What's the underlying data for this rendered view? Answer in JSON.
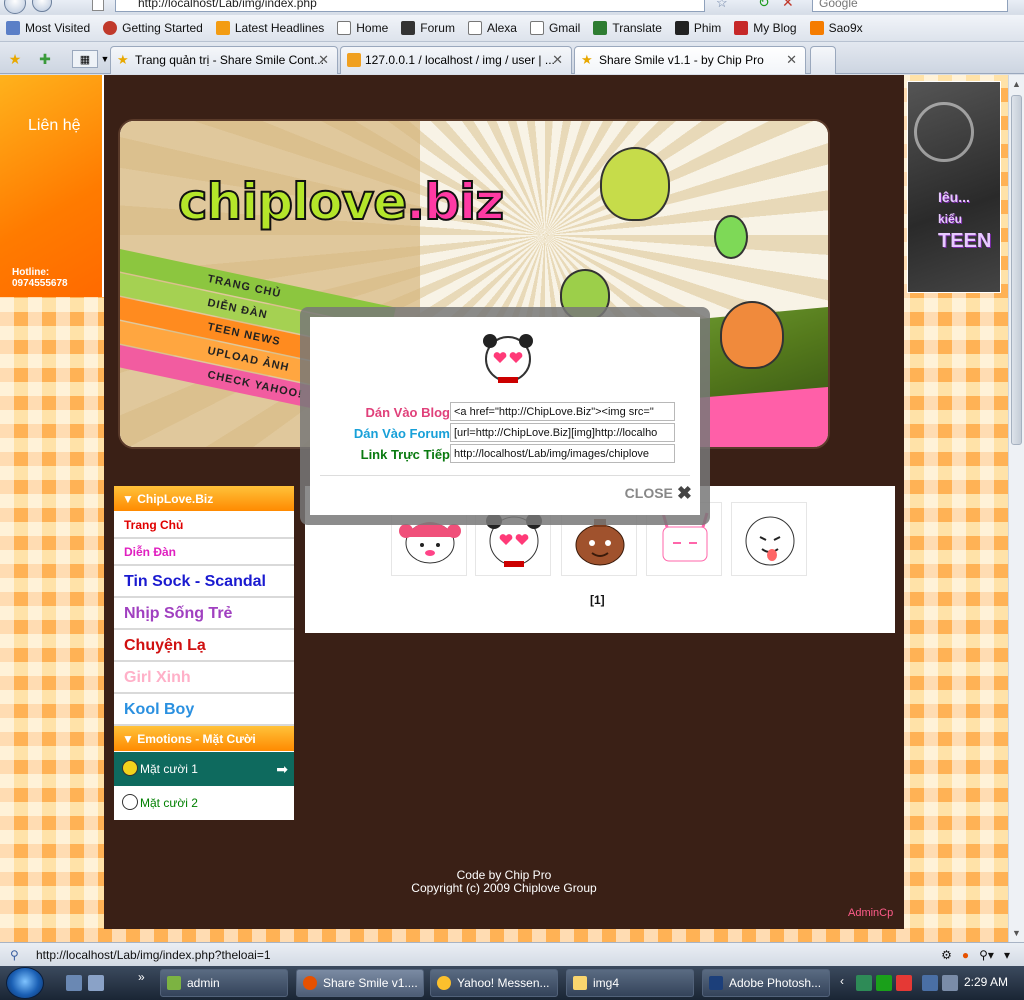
{
  "browser": {
    "url": "http://localhost/Lab/img/index.php",
    "search_placeholder": "Google",
    "bookmarks": [
      {
        "label": "Most Visited",
        "icon": "most-visited-icon",
        "color": "#5b7fc7"
      },
      {
        "label": "Getting Started",
        "icon": "firefox-icon",
        "color": "#c0392b"
      },
      {
        "label": "Latest Headlines",
        "icon": "rss-icon",
        "color": "#f39c12"
      },
      {
        "label": "Home",
        "icon": "page-icon",
        "color": "#ffffff"
      },
      {
        "label": "Forum",
        "icon": "forum-icon",
        "color": "#333333"
      },
      {
        "label": "Alexa",
        "icon": "page-icon",
        "color": "#ffffff"
      },
      {
        "label": "Gmail",
        "icon": "page-icon",
        "color": "#ffffff"
      },
      {
        "label": "Translate",
        "icon": "translate-icon",
        "color": "#2e7d32"
      },
      {
        "label": "Phim",
        "icon": "film-icon",
        "color": "#222222"
      },
      {
        "label": "My Blog",
        "icon": "yahoo-icon",
        "color": "#c62828"
      },
      {
        "label": "Sao9x",
        "icon": "sao9x-icon",
        "color": "#f57c00"
      }
    ],
    "tabs": [
      {
        "label": "Trang quản trị - Share Smile Cont...",
        "active": false
      },
      {
        "label": "127.0.0.1 / localhost / img / user | ...",
        "active": false
      },
      {
        "label": "Share Smile v1.1 - by Chip Pro",
        "active": true
      }
    ],
    "status_text": "http://localhost/Lab/img/index.php?theloai=1"
  },
  "page": {
    "left_banner": {
      "contact": "Liên hệ",
      "hotline": "Hotline: 0974555678"
    },
    "right_banner": {
      "text": [
        "Iêu...",
        "kiểu",
        "TEEN"
      ]
    },
    "logo": {
      "part1": "chiplove",
      "part2": ".biz"
    },
    "banner_nav": [
      "TRANG CHỦ",
      "DIỄN ĐÀN",
      "TEEN NEWS",
      "UPLOAD ẢNH",
      "CHECK YAHOO!"
    ],
    "menu": {
      "header": "▼ ChipLove.Biz",
      "items": [
        {
          "label": "Trang Chủ",
          "color": "#e00000",
          "size": "sm"
        },
        {
          "label": "Diễn Đàn",
          "color": "#e020c0",
          "size": "sm"
        },
        {
          "label": "Tin Sock - Scandal",
          "color": "#1a1ad0",
          "size": "lg"
        },
        {
          "label": "Nhịp Sống Trẻ",
          "color": "#a040c0",
          "size": "lg"
        },
        {
          "label": "Chuyện Lạ",
          "color": "#d01010",
          "size": "lg"
        },
        {
          "label": "Girl Xinh",
          "color": "#ffb0c8",
          "size": "lg"
        },
        {
          "label": "Kool Boy",
          "color": "#2a90e0",
          "size": "lg"
        }
      ],
      "emo_header": "▼ Emotions - Mặt Cười",
      "emo_items": [
        {
          "label": "Mặt cười 1",
          "active": true
        },
        {
          "label": "Mặt cười 2",
          "active": false
        }
      ]
    },
    "modal": {
      "rows": [
        {
          "label": "Dán Vào Blog",
          "value": "<a href=\"http://ChipLove.Biz\"><img src=\"",
          "color": "#e0407a"
        },
        {
          "label": "Dán Vào Forum",
          "value": "[url=http://ChipLove.Biz][img]http://localho",
          "color": "#18a0d8"
        },
        {
          "label": "Link Trực Tiếp",
          "value": "http://localhost/Lab/img/images/chiplove",
          "color": "#0a7a10"
        }
      ],
      "close_label": "CLOSE"
    },
    "pager": "[1]",
    "footer": {
      "line1": "Code by Chip Pro",
      "line2": "Copyright (c) 2009 Chiplove Group"
    },
    "admin_link": "AdminCp"
  },
  "taskbar": {
    "buttons": [
      {
        "label": "admin",
        "icon": "notepad-icon",
        "color": "#7cb342"
      },
      {
        "label": "Share Smile v1....",
        "icon": "firefox-icon",
        "color": "#e65100",
        "active": true
      },
      {
        "label": "Yahoo! Messen...",
        "icon": "yahoo-messenger-icon",
        "color": "#fbc02d"
      },
      {
        "label": "img4",
        "icon": "folder-icon",
        "color": "#f9d56e"
      },
      {
        "label": "Adobe Photosh...",
        "icon": "photoshop-icon",
        "color": "#1c3f7a"
      }
    ],
    "clock": "2:29 AM"
  }
}
